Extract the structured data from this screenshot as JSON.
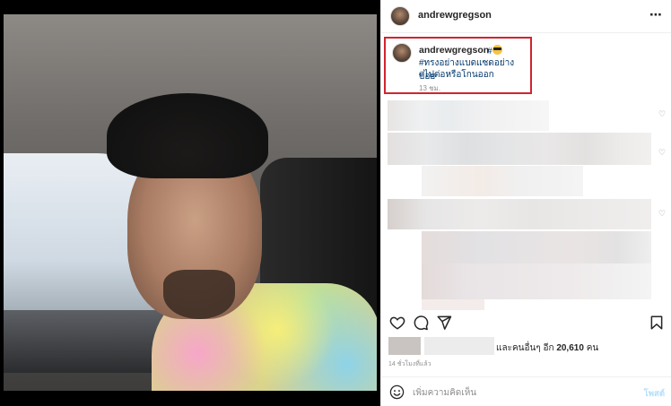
{
  "post": {
    "username": "andrewgregson",
    "more_icon": "⋯"
  },
  "caption": {
    "username": "andrewgregson",
    "hash_prefix": "#",
    "tag_line_1": "#ทรงอย่างแบดแซดอย่างบ่อย",
    "tag_line_2": "#ไปต่อหรือโกนออก",
    "time": "13 ชม.",
    "highlight_color": "#d1242f"
  },
  "actions": {
    "like_icon": "heart-icon",
    "comment_icon": "comment-icon",
    "share_icon": "share-icon",
    "save_icon": "bookmark-icon"
  },
  "likes": {
    "text_prefix": "และคนอื่นๆ อีก",
    "count": "20,610",
    "text_suffix": "คน"
  },
  "time_ago": "14 ชั่วโมงที่แล้ว",
  "comment_box": {
    "placeholder": "เพิ่มความคิดเห็น",
    "post_label": "โพสต์"
  }
}
